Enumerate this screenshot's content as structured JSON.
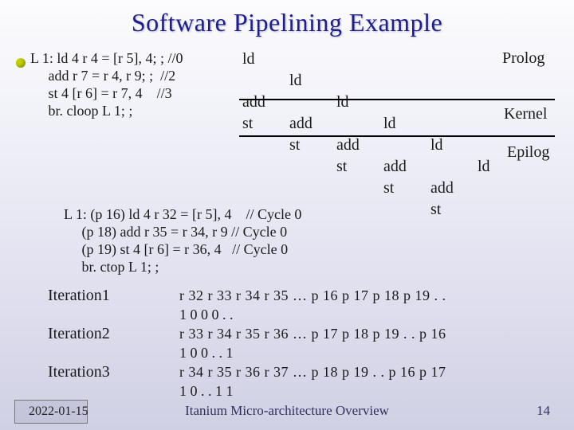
{
  "title": "Software Pipelining Example",
  "loop1": {
    "l1": "L 1: ld 4 r 4 = [r 5], 4; ; //0",
    "l2": "     add r 7 = r 4, r 9; ;  //2",
    "l3": "     st 4 [r 6] = r 7, 4    //3",
    "l4": "     br. cloop L 1; ;"
  },
  "sched": {
    "r0": [
      "ld",
      "",
      "",
      "",
      "",
      ""
    ],
    "r1": [
      "",
      "ld",
      "",
      "",
      "",
      ""
    ],
    "r2": [
      "add",
      "",
      "ld",
      "",
      "",
      ""
    ],
    "r3": [
      "st",
      "add",
      "",
      "ld",
      "",
      ""
    ],
    "r4": [
      "",
      "st",
      "add",
      "",
      "ld",
      ""
    ],
    "r5": [
      "",
      "",
      "st",
      "add",
      "",
      "ld"
    ],
    "r6": [
      "",
      "",
      "",
      "st",
      "add",
      ""
    ],
    "r7": [
      "",
      "",
      "",
      "",
      "st",
      ""
    ]
  },
  "labels": {
    "prolog": "Prolog",
    "kernel": "Kernel",
    "epilog": "Epilog"
  },
  "loop2": {
    "l1": "L 1: (p 16) ld 4 r 32 = [r 5], 4    // Cycle 0",
    "l2": "     (p 18) add r 35 = r 34, r 9 // Cycle 0",
    "l3": "     (p 19) st 4 [r 6] = r 36, 4   // Cycle 0",
    "l4": "     br. ctop L 1; ;"
  },
  "iters": {
    "it1": "Iteration1",
    "it2": "Iteration2",
    "it3": "Iteration3",
    "row1a": "r 32 r 33 r 34 r 35 … p 16 p 17 p 18 p 19   . .",
    "row1b": "                           1     0     0     0    . .",
    "row2a": "r 33 r 34 r 35 r 36 … p 17 p 18 p 19    . .    p 16",
    "row2b": "                           1     0     0    . .      1",
    "row3a": "r 34 r 35 r 36 r 37 … p 18 p 19    . .   p 16  p 17",
    "row3b": "                           1     0    . .      1      1"
  },
  "footer": {
    "date": "2022-01-15",
    "mid": "Itanium Micro-architecture Overview",
    "num": "14"
  }
}
